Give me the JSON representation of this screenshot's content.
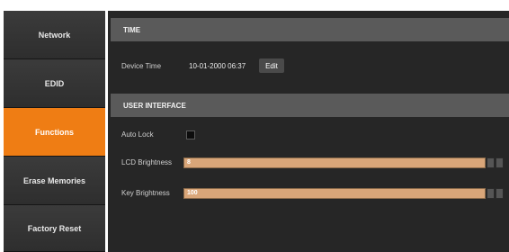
{
  "sidebar": {
    "items": [
      {
        "label": "Network"
      },
      {
        "label": "EDID"
      },
      {
        "label": "Functions"
      },
      {
        "label": "Erase Memories"
      },
      {
        "label": "Factory Reset"
      }
    ]
  },
  "time_section": {
    "header": "TIME",
    "device_time_label": "Device Time",
    "device_time_value": "10-01-2000 06:37",
    "edit_label": "Edit"
  },
  "ui_section": {
    "header": "USER INTERFACE",
    "auto_lock_label": "Auto Lock",
    "auto_lock_checked": false,
    "lcd_label": "LCD Brightness",
    "lcd_value": "8",
    "key_label": "Key Brightness",
    "key_value": "100"
  },
  "colors": {
    "accent": "#ef7d14",
    "slider": "#d9a679"
  }
}
